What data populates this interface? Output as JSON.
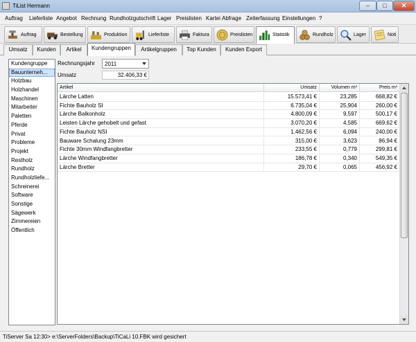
{
  "window": {
    "title": "TiList  Hermann",
    "minimize": "–",
    "maximize": "□",
    "close": "✕"
  },
  "menu": [
    "Auftrag",
    "Lieferliste",
    "Angebot",
    "Rechnung",
    "Rundholzgutschrift",
    "Lager",
    "Preislisten",
    "Kartei",
    "Abfrage",
    "Zeiterfassung",
    "Einstellungen",
    "?"
  ],
  "toolbar": [
    {
      "label": "Auftrag",
      "icon": "hammer-icon",
      "color": "#8a6d3b"
    },
    {
      "label": "Bestellung",
      "icon": "truck-icon",
      "color": "#6b4f2a"
    },
    {
      "label": "Produktion",
      "icon": "production-icon",
      "color": "#c9a437"
    },
    {
      "label": "Lieferliste",
      "icon": "forklift-icon",
      "color": "#d7b22e"
    },
    {
      "label": "Faktura",
      "icon": "printer-icon",
      "color": "#555555"
    },
    {
      "label": "Preislisten",
      "icon": "coin-icon",
      "color": "#e0c15a"
    },
    {
      "label": "Statistik",
      "icon": "chart-icon",
      "color": "#2e8b2e"
    },
    {
      "label": "Rundholz",
      "icon": "logs-icon",
      "color": "#b58a3a"
    },
    {
      "label": "Lager",
      "icon": "magnifier-icon",
      "color": "#4a7ab0"
    },
    {
      "label": "Noti",
      "icon": "notes-icon",
      "color": "#d9b24a"
    }
  ],
  "tabs": [
    "Umsatz",
    "Kunden",
    "Artikel",
    "Kundengruppen",
    "Artikelgruppen",
    "Top Kunden",
    "Kunden Export"
  ],
  "groups": {
    "header": "Kundengruppe",
    "items": [
      "Bauunterneh...",
      "Holzbau",
      "Holzhandel",
      "Maschinen",
      "Mitarbeiter",
      "Paletten",
      "Pferde",
      "Privat",
      "Probleme",
      "Projekt",
      "Restholz",
      "Rundholz",
      "Rundholzliefe...",
      "Schreinerei",
      "Software",
      "Sonstige",
      "Sägewerk",
      "Zimmereien",
      "Öffentlich"
    ]
  },
  "filters": {
    "year_label": "Rechnungsjahr",
    "year_value": "2011",
    "umsatz_label": "Umsatz",
    "umsatz_value": "32.406,33 €"
  },
  "table": {
    "columns": [
      "Artikel",
      "Umsatz",
      "Volumen m³",
      "Preis m³"
    ],
    "rows": [
      [
        "Lärche Latten",
        "15.573,41 €",
        "23,285",
        "668,82 €"
      ],
      [
        "Fichte Bauholz SI",
        "6.735,04 €",
        "25,904",
        "260,00 €"
      ],
      [
        "Lärche Balkonholz",
        "4.800,09 €",
        "9,597",
        "500,17 €"
      ],
      [
        "Leisten Lärche gehobelt und gefast",
        "3.070,20 €",
        "4,585",
        "669,62 €"
      ],
      [
        "Fichte Bauholz NSI",
        "1.462,56 €",
        "6,094",
        "240,00 €"
      ],
      [
        "Bauware Schalung 23mm",
        "315,00 €",
        "3,623",
        "86,94 €"
      ],
      [
        "Fichte 30mm Windfangbretter",
        "233,55 €",
        "0,779",
        "299,81 €"
      ],
      [
        "Lärche Windfangbretter",
        "186,78 €",
        "0,340",
        "549,35 €"
      ],
      [
        "Lärche Bretter",
        "29,70 €",
        "0,065",
        "456,92 €"
      ]
    ]
  },
  "status": "TiServer Sa 12:30> e:\\ServerFolders\\Backup\\TiCaLi 10.FBK wird gesichert"
}
